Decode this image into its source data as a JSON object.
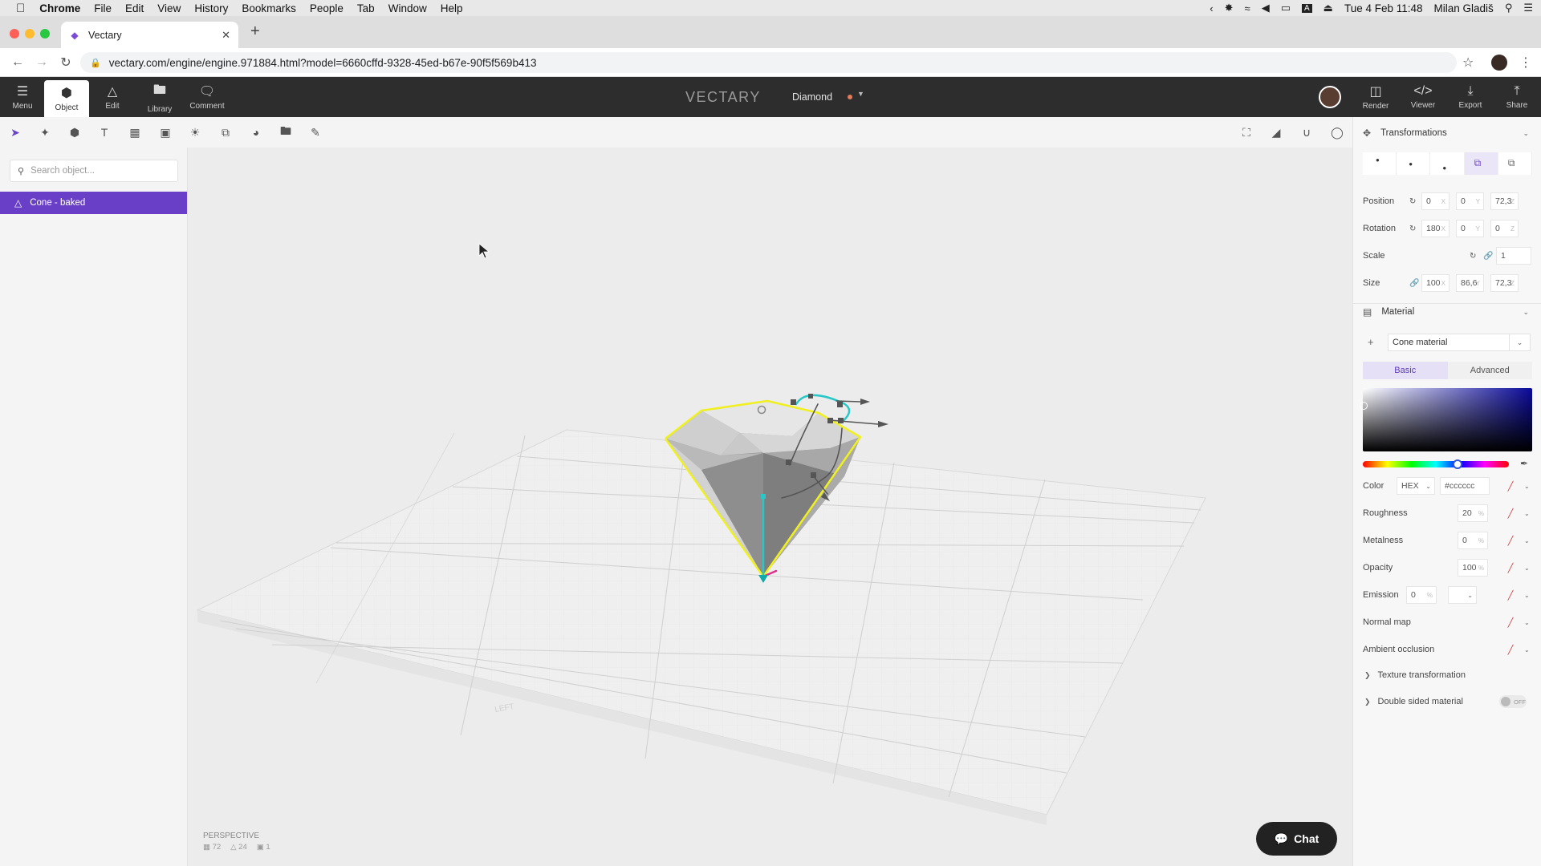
{
  "os_menu": {
    "app": "Chrome",
    "items": [
      "File",
      "Edit",
      "View",
      "History",
      "Bookmarks",
      "People",
      "Tab",
      "Window",
      "Help"
    ],
    "datetime": "Tue 4 Feb  11:48",
    "user": "Milan Gladiš"
  },
  "browser": {
    "tab_title": "Vectary",
    "url": "vectary.com/engine/engine.971884.html?model=6660cffd-9328-45ed-b67e-90f5f569b413"
  },
  "app": {
    "brand": "VECTARY",
    "document_name": "Diamond",
    "top_left": [
      {
        "label": "Menu",
        "icon": "hamburger-icon"
      },
      {
        "label": "Object",
        "icon": "cube-icon"
      },
      {
        "label": "Edit",
        "icon": "vertex-icon"
      },
      {
        "label": "Library",
        "icon": "folder-icon"
      },
      {
        "label": "Comment",
        "icon": "comment-icon"
      }
    ],
    "top_right": [
      {
        "label": "Render",
        "icon": "render-icon"
      },
      {
        "label": "Viewer",
        "icon": "code-icon"
      },
      {
        "label": "Export",
        "icon": "download-icon"
      },
      {
        "label": "Share",
        "icon": "share-icon"
      }
    ]
  },
  "left_panel": {
    "search_placeholder": "Search object...",
    "objects": [
      "Cone - baked"
    ]
  },
  "viewport": {
    "camera": "PERSPECTIVE",
    "stats": {
      "faces": "72",
      "vertices": "24",
      "objects": "1"
    },
    "grid_label": "LEFT",
    "chat_label": "Chat"
  },
  "transformations": {
    "title": "Transformations",
    "position": {
      "label": "Position",
      "x": "0",
      "y": "0",
      "z": "72,3"
    },
    "rotation": {
      "label": "Rotation",
      "x": "180",
      "y": "0",
      "z": "0"
    },
    "scale": {
      "label": "Scale",
      "value": "1"
    },
    "size": {
      "label": "Size",
      "x": "100",
      "y": "86,6",
      "z": "72,3"
    },
    "axis_x": "X",
    "axis_y": "Y",
    "axis_z": "Z"
  },
  "material": {
    "title": "Material",
    "name": "Cone material",
    "tabs": [
      "Basic",
      "Advanced"
    ],
    "color_label": "Color",
    "color_format": "HEX",
    "color_value": "#cccccc",
    "roughness": {
      "label": "Roughness",
      "value": "20",
      "unit": "%"
    },
    "metalness": {
      "label": "Metalness",
      "value": "0",
      "unit": "%"
    },
    "opacity": {
      "label": "Opacity",
      "value": "100",
      "unit": "%"
    },
    "emission": {
      "label": "Emission",
      "value": "0",
      "unit": "%"
    },
    "normal_map": "Normal map",
    "ambient_occlusion": "Ambient occlusion",
    "texture_transformation": "Texture transformation",
    "double_sided": "Double sided material",
    "toggle_state": "OFF"
  },
  "colors": {
    "accent": "#6a3fc8",
    "topbar": "#2d2d2d",
    "selection_outline": "#f0f020",
    "gizmo": "#28c8c8"
  }
}
